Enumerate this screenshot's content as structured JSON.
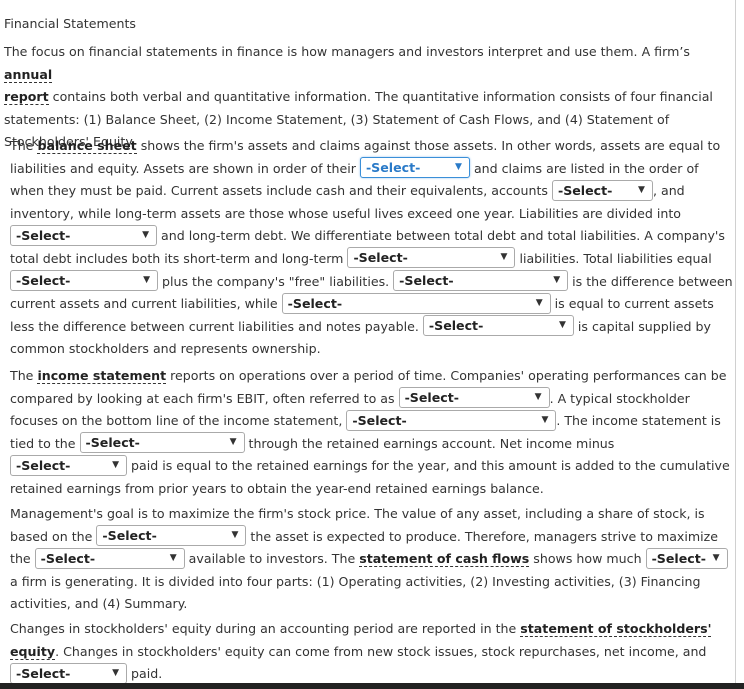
{
  "title": "Financial Statements",
  "intro": {
    "t1": "The focus on financial statements in finance is how managers and investors interpret and use them. A firm’s ",
    "kw_annual_report_1": "annual",
    "kw_annual_report_2": "report",
    "t2": " contains both verbal and quantitative information. The quantitative information consists of four financial statements: (1) Balance Sheet, (2) Income Statement, (3) Statement of Cash Flows, and (4) Statement of Stockholders' Equity."
  },
  "select_placeholder": "-Select-",
  "arrow": "▼",
  "balance": {
    "t1": "The ",
    "kw": "balance sheet",
    "t2": " shows the firm's assets and claims against those assets. In other words, assets are equal to liabilities and equity. Assets are shown in order of their ",
    "t3": " and claims are listed in the order of when they must be paid. Current assets include cash and their equivalents, accounts ",
    "t4": ", and inventory, while long-term assets are those whose useful lives exceed one year. Liabilities are divided into ",
    "t5": " and long-term debt. We differentiate between total debt and total liabilities. A company's total debt includes both its short-term and long-term ",
    "t6": " liabilities. Total liabilities equal ",
    "t7": " plus the company's \"free\" liabilities. ",
    "t8": " is the difference between current assets and current liabilities, while ",
    "t9": " is equal to current assets less the difference between current liabilities and notes payable. ",
    "t10": " is capital supplied by common stockholders and represents ownership."
  },
  "income": {
    "t1": "The ",
    "kw": "income statement",
    "t2": " reports on operations over a period of time. Companies' operating performances can be compared by looking at each firm's EBIT, often referred to as ",
    "t3": ". A typical stockholder focuses on the bottom line of the income statement, ",
    "t4": ". The income statement is tied to the ",
    "t5": " through the retained earnings account. Net income minus ",
    "t6": " paid is equal to the retained earnings for the year, and this amount is added to the cumulative retained earnings from prior years to obtain the year-end retained earnings balance."
  },
  "cashflow": {
    "t1": "Management's goal is to maximize the firm's stock price. The value of any asset, including a share of stock, is based on the ",
    "t2": " the asset is expected to produce. Therefore, managers strive to maximize the ",
    "t3": " available to investors. The ",
    "kw": "statement of cash flows",
    "t4": " shows how much ",
    "t5": " a firm is generating. It is divided into four parts: (1) Operating activities, (2) Investing activities, (3) Financing activities, and (4) Summary."
  },
  "equity": {
    "t1": "Changes in stockholders' equity during an accounting period are reported in the ",
    "kw": "statement of stockholders' equity",
    "t2": ". Changes in stockholders' equity can come from new stock issues, stock repurchases, net income, and ",
    "t3": " paid."
  }
}
